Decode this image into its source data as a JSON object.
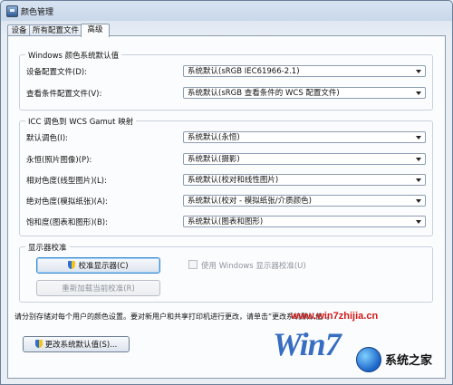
{
  "window": {
    "title": "颜色管理"
  },
  "tabs": [
    {
      "label": "设备",
      "active": false
    },
    {
      "label": "所有配置文件",
      "active": false
    },
    {
      "label": "高级",
      "active": true
    }
  ],
  "windows_defaults": {
    "legend": "Windows 颜色系统默认值",
    "rows": [
      {
        "label": "设备配置文件(D):",
        "value": "系统默认(sRGB IEC61966-2.1)"
      },
      {
        "label": "查看条件配置文件(V):",
        "value": "系统默认(sRGB 查看条件的 WCS 配置文件)"
      }
    ]
  },
  "icc_mapping": {
    "legend": "ICC 调色到 WCS Gamut 映射",
    "rows": [
      {
        "label": "默认调色(I):",
        "value": "系统默认(永恒)"
      },
      {
        "label": "永恒(照片图像)(P):",
        "value": "系统默认(摄影)"
      },
      {
        "label": "相对色度(线型图片)(L):",
        "value": "系统默认(校对和线性图片)"
      },
      {
        "label": "绝对色度(模拟纸张)(A):",
        "value": "系统默认(校对 - 模拟纸张/介质颜色)"
      },
      {
        "label": "饱和度(图表和图形)(B):",
        "value": "系统默认(图表和图形)"
      }
    ]
  },
  "display_calibration": {
    "legend": "显示器校准",
    "calibrate_button": "校准显示器(C)",
    "reload_button": "重新加载当前校准(R)",
    "use_windows_checkbox": "使用 Windows 显示器校准(U)",
    "use_windows_checked": false
  },
  "note": "请分别存储对每个用户的颜色设置。要对新用户和共享打印机进行更改，请单击“更改系统默认值”。",
  "change_defaults_button": "更改系统默认值(S)...",
  "watermark": {
    "url": "www.win7zhijia.cn",
    "win_text": "Win7",
    "site_name": "系统之家"
  },
  "colors": {
    "accent": "#3c8ad0",
    "watermark_red": "#d21a1a",
    "watermark_blue": "#1756b8"
  }
}
